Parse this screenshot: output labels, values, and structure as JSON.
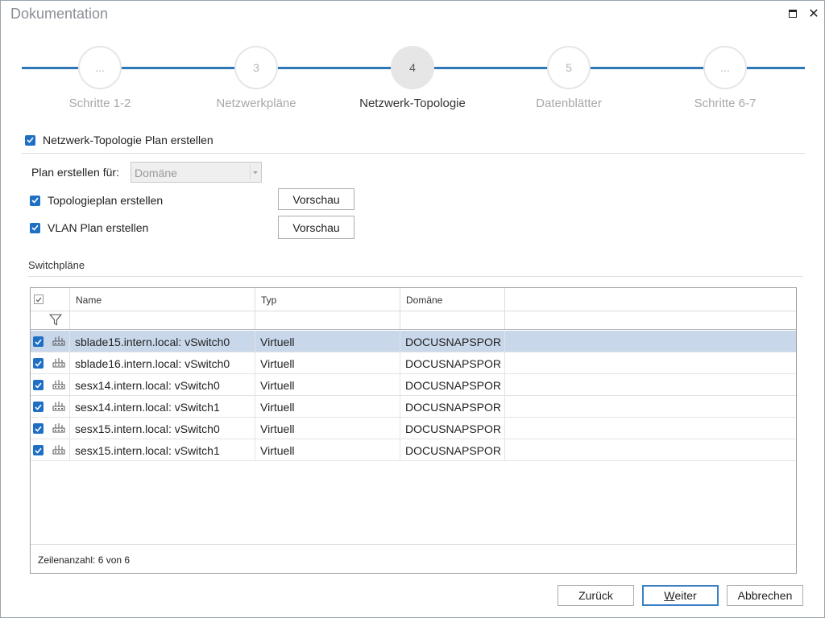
{
  "window": {
    "title": "Dokumentation"
  },
  "stepper": {
    "steps": [
      {
        "number": "...",
        "label": "Schritte 1-2",
        "active": false
      },
      {
        "number": "3",
        "label": "Netzwerkpläne",
        "active": false
      },
      {
        "number": "4",
        "label": "Netzwerk-Topologie",
        "active": true
      },
      {
        "number": "5",
        "label": "Datenblätter",
        "active": false
      },
      {
        "number": "...",
        "label": "Schritte 6-7",
        "active": false
      }
    ]
  },
  "options": {
    "main_checkbox_label": "Netzwerk-Topologie Plan erstellen",
    "main_checked": true,
    "plan_for_label": "Plan erstellen für:",
    "plan_for_value": "Domäne",
    "topology_label": "Topologieplan erstellen",
    "topology_checked": true,
    "vlan_label": "VLAN Plan erstellen",
    "vlan_checked": true,
    "preview_label": "Vorschau"
  },
  "switch_section": {
    "title": "Switchpläne"
  },
  "grid": {
    "columns": [
      "Name",
      "Typ",
      "Domäne"
    ],
    "rows": [
      {
        "name": "sblade15.intern.local: vSwitch0",
        "type": "Virtuell",
        "domain": "DOCUSNAPSPOR...",
        "checked": true,
        "selected": true
      },
      {
        "name": "sblade16.intern.local: vSwitch0",
        "type": "Virtuell",
        "domain": "DOCUSNAPSPOR...",
        "checked": true,
        "selected": false
      },
      {
        "name": "sesx14.intern.local: vSwitch0",
        "type": "Virtuell",
        "domain": "DOCUSNAPSPOR...",
        "checked": true,
        "selected": false
      },
      {
        "name": "sesx14.intern.local: vSwitch1",
        "type": "Virtuell",
        "domain": "DOCUSNAPSPOR...",
        "checked": true,
        "selected": false
      },
      {
        "name": "sesx15.intern.local: vSwitch0",
        "type": "Virtuell",
        "domain": "DOCUSNAPSPOR...",
        "checked": true,
        "selected": false
      },
      {
        "name": "sesx15.intern.local: vSwitch1",
        "type": "Virtuell",
        "domain": "DOCUSNAPSPOR...",
        "checked": true,
        "selected": false
      }
    ],
    "row_count_text": "Zeilenanzahl: 6 von 6"
  },
  "footer": {
    "back_label": "Zurück",
    "next_label_underlined": "W",
    "next_label_rest": "eiter",
    "cancel_label": "Abbrechen"
  },
  "colors": {
    "accent": "#2f78b8",
    "checkbox": "#1f6fc5",
    "selection": "#c8d7ea"
  }
}
